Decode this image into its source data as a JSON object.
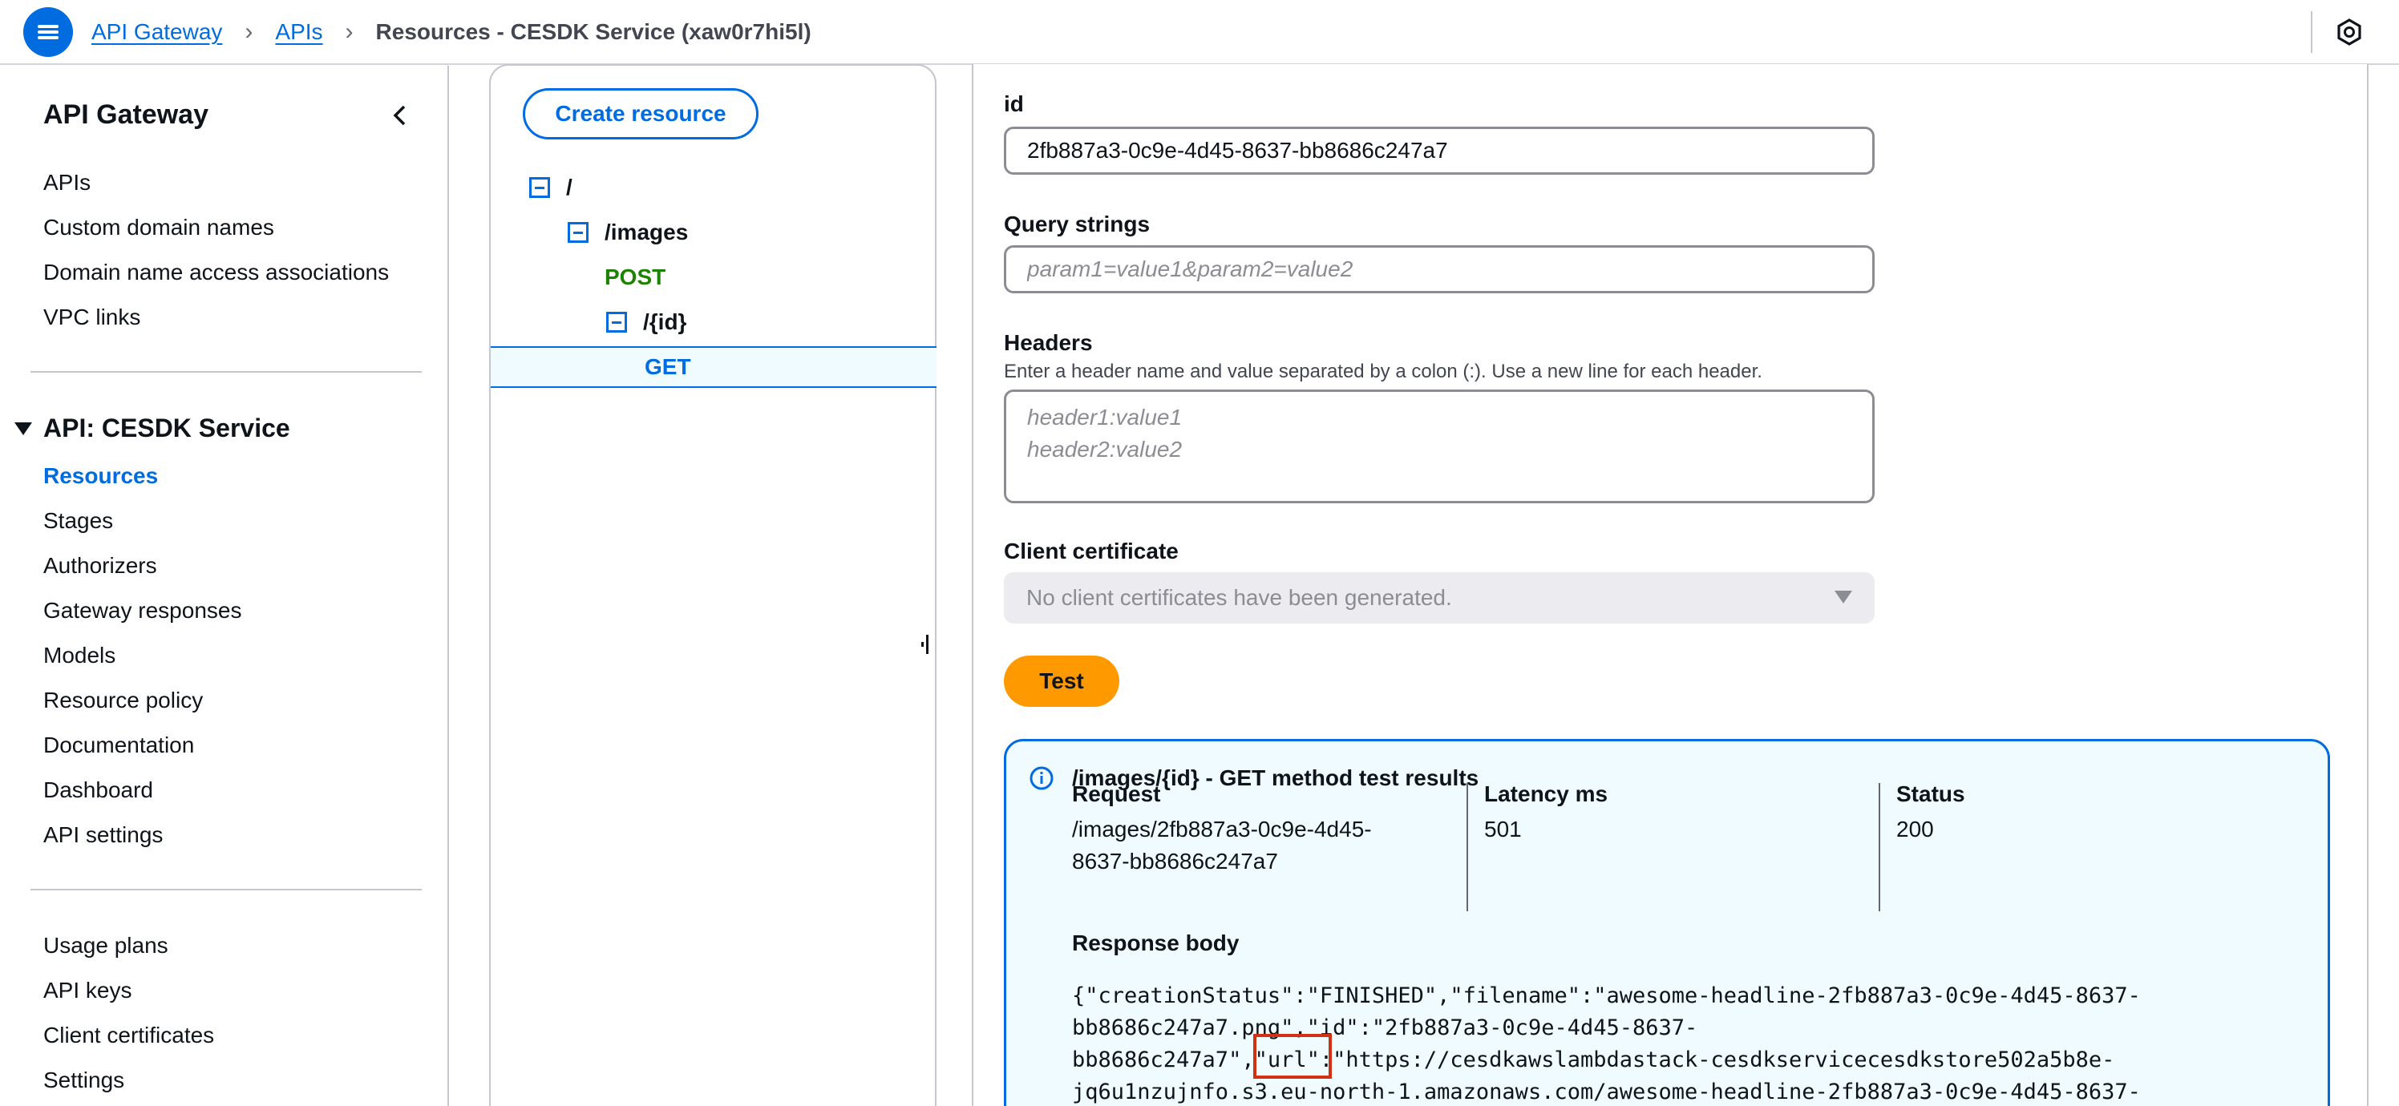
{
  "breadcrumbs": [
    {
      "label": "API Gateway"
    },
    {
      "label": "APIs"
    },
    {
      "label": "Resources - CESDK Service (xaw0r7hi5l)"
    }
  ],
  "sidenav": {
    "title": "API Gateway",
    "top_items": [
      "APIs",
      "Custom domain names",
      "Domain name access associations",
      "VPC links"
    ],
    "group_title": "API: CESDK Service",
    "group_items": [
      "Resources",
      "Stages",
      "Authorizers",
      "Gateway responses",
      "Models",
      "Resource policy",
      "Documentation",
      "Dashboard",
      "API settings"
    ],
    "bottom_items": [
      "Usage plans",
      "API keys",
      "Client certificates",
      "Settings"
    ]
  },
  "tree": {
    "create_label": "Create resource",
    "root": "/",
    "images": "/images",
    "post": "POST",
    "id": "/{id}",
    "get": "GET"
  },
  "form": {
    "id_label": "id",
    "id_value": "2fb887a3-0c9e-4d45-8637-bb8686c247a7",
    "query_label": "Query strings",
    "query_placeholder": "param1=value1&param2=value2",
    "headers_label": "Headers",
    "headers_desc": "Enter a header name and value separated by a colon (:). Use a new line for each header.",
    "headers_placeholder": "header1:value1\nheader2:value2",
    "cert_label": "Client certificate",
    "cert_value": "No client certificates have been generated.",
    "test_label": "Test"
  },
  "results": {
    "title": "/images/{id} - GET method test results",
    "request_label": "Request",
    "request_value": "/images/2fb887a3-0c9e-4d45-\n8637-bb8686c247a7",
    "latency_label": "Latency ms",
    "latency_value": "501",
    "status_label": "Status",
    "status_value": "200",
    "response_label": "Response body",
    "response_body": "{\"creationStatus\":\"FINISHED\",\"filename\":\"awesome-headline-2fb887a3-0c9e-4d45-8637-\nbb8686c247a7.png\",\"id\":\"2fb887a3-0c9e-4d45-8637-\nbb8686c247a7\",\"url\":\"https://cesdkawslambdastack-cesdkservicecesdkstore502a5b8e-\njq6u1nzujnfo.s3.eu-north-1.amazonaws.com/awesome-headline-2fb887a3-0c9e-4d45-8637-"
  },
  "colors": {
    "accent": "#006ce0",
    "primary_button": "#ff9900",
    "post_method": "#1d8102",
    "highlight": "#d13212"
  },
  "icons": [
    "menu-icon",
    "chevron-right-icon",
    "cloudshell-icon",
    "chevron-left-icon",
    "caret-down-icon",
    "minus-square-icon",
    "info-icon"
  ]
}
